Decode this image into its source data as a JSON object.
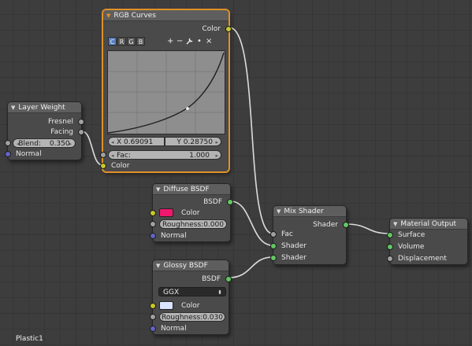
{
  "nodes": {
    "layer_weight": {
      "title": "Layer Weight",
      "outputs": [
        "Fresnel",
        "Facing"
      ],
      "blend_label": "Blend:",
      "blend_value": "0.350",
      "normal_label": "Normal"
    },
    "rgb_curves": {
      "title": "RGB Curves",
      "output": "Color",
      "channels": [
        "C",
        "R",
        "G",
        "B"
      ],
      "active_channel": "C",
      "tools": [
        "+",
        "−",
        "wrench",
        "•",
        "×"
      ],
      "x_label": "X 0.69091",
      "y_label": "Y 0.28750",
      "fac_label": "Fac:",
      "fac_value": "1.000",
      "color_input": "Color"
    },
    "diffuse_bsdf": {
      "title": "Diffuse BSDF",
      "output": "BSDF",
      "color_label": "Color",
      "color_value": "#f0186e",
      "roughness_label": "Roughness:",
      "roughness_value": "0.000",
      "normal_label": "Normal"
    },
    "glossy_bsdf": {
      "title": "Glossy BSDF",
      "output": "BSDF",
      "distribution": "GGX",
      "color_label": "Color",
      "color_value": "#d9e4ff",
      "roughness_label": "Roughness:",
      "roughness_value": "0.030",
      "normal_label": "Normal"
    },
    "mix_shader": {
      "title": "Mix Shader",
      "output": "Shader",
      "inputs": [
        "Fac",
        "Shader",
        "Shader"
      ]
    },
    "material_output": {
      "title": "Material Output",
      "inputs": [
        "Surface",
        "Volume",
        "Displacement"
      ]
    }
  },
  "status": {
    "material_name": "Plastic1"
  },
  "colors": {
    "socket_float": "#a1a1a1",
    "socket_color": "#c7c729",
    "socket_vector": "#6363c7",
    "socket_shader": "#63c763",
    "active_border": "#e0912a",
    "channel_active": "#5680c2"
  },
  "icons": {
    "collapse": "triangle-down-icon",
    "wrench": "wrench-icon",
    "add": "plus-icon",
    "remove": "minus-icon",
    "close": "close-icon"
  }
}
